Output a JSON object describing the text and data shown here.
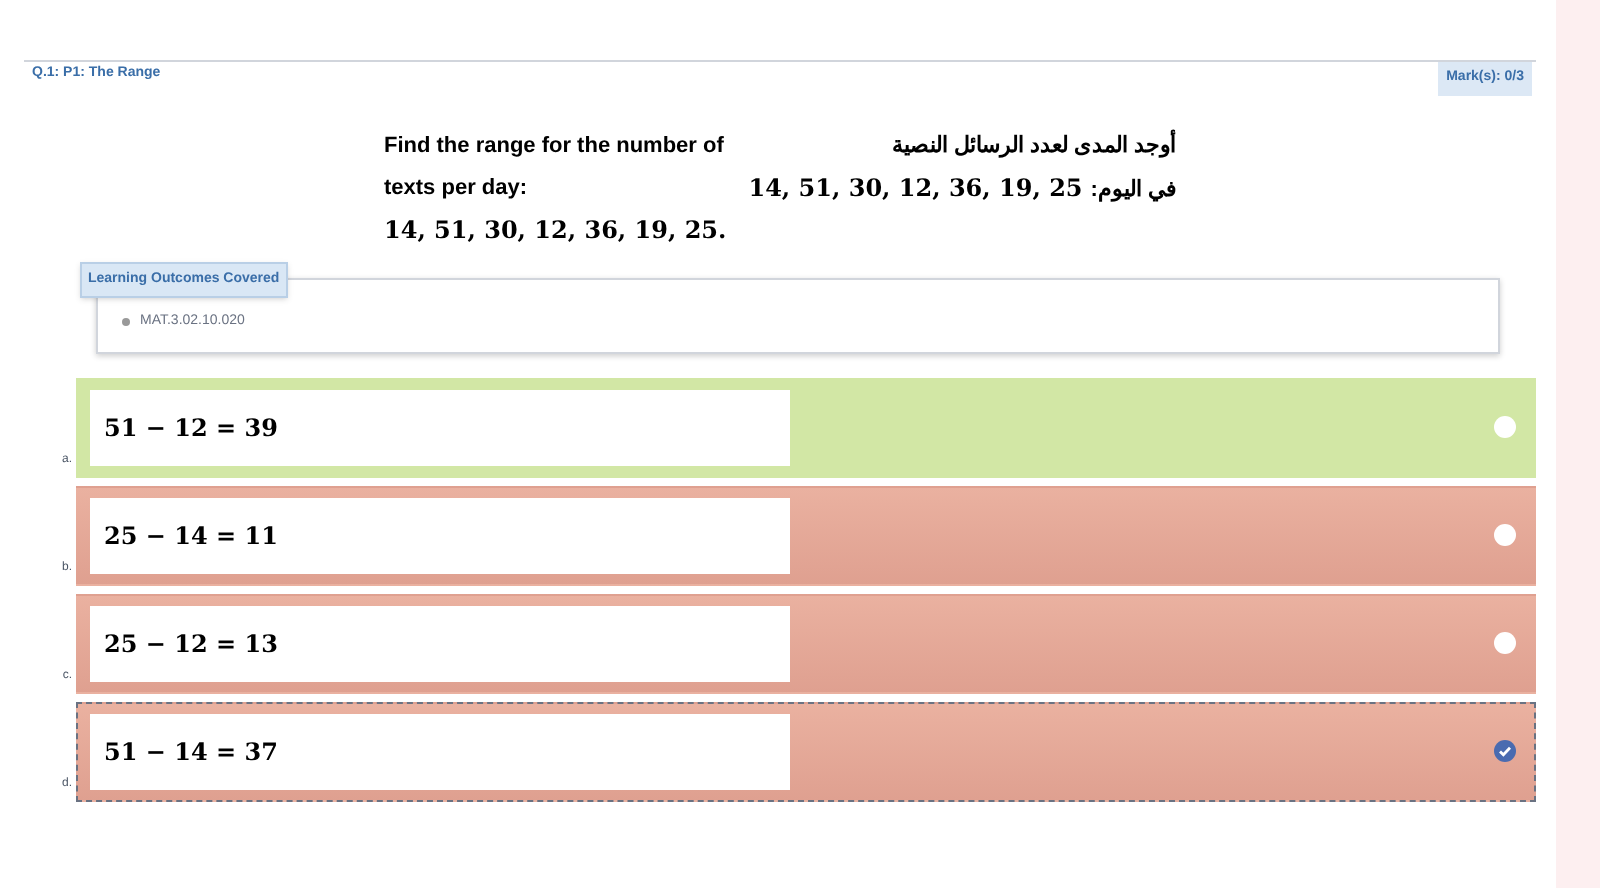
{
  "question": {
    "title": "Q.1: P1: The Range",
    "marks": "Mark(s): 0/3"
  },
  "prompt": {
    "english": [
      "Find the range for the number of",
      "texts per day:"
    ],
    "english_numbers": "14, 51, 30, 12, 36, 19, 25.",
    "arabic_line": "أوجد المدى لعدد الرسائل النصية",
    "arabic_label": "في اليوم:",
    "arabic_numbers": "14, 51, 30, 12, 36, 19, 25"
  },
  "outcomes": {
    "label": "Learning Outcomes Covered",
    "items": [
      "MAT.3.02.10.020"
    ]
  },
  "options": [
    {
      "letter": "a.",
      "text": "51 − 12 = 39",
      "correct": true,
      "selected": false
    },
    {
      "letter": "b.",
      "text": "25 − 14 = 11",
      "correct": false,
      "selected": false
    },
    {
      "letter": "c.",
      "text": "25 − 12 = 13",
      "correct": false,
      "selected": false
    },
    {
      "letter": "d.",
      "text": "51 − 14 = 37",
      "correct": false,
      "selected": true
    }
  ]
}
